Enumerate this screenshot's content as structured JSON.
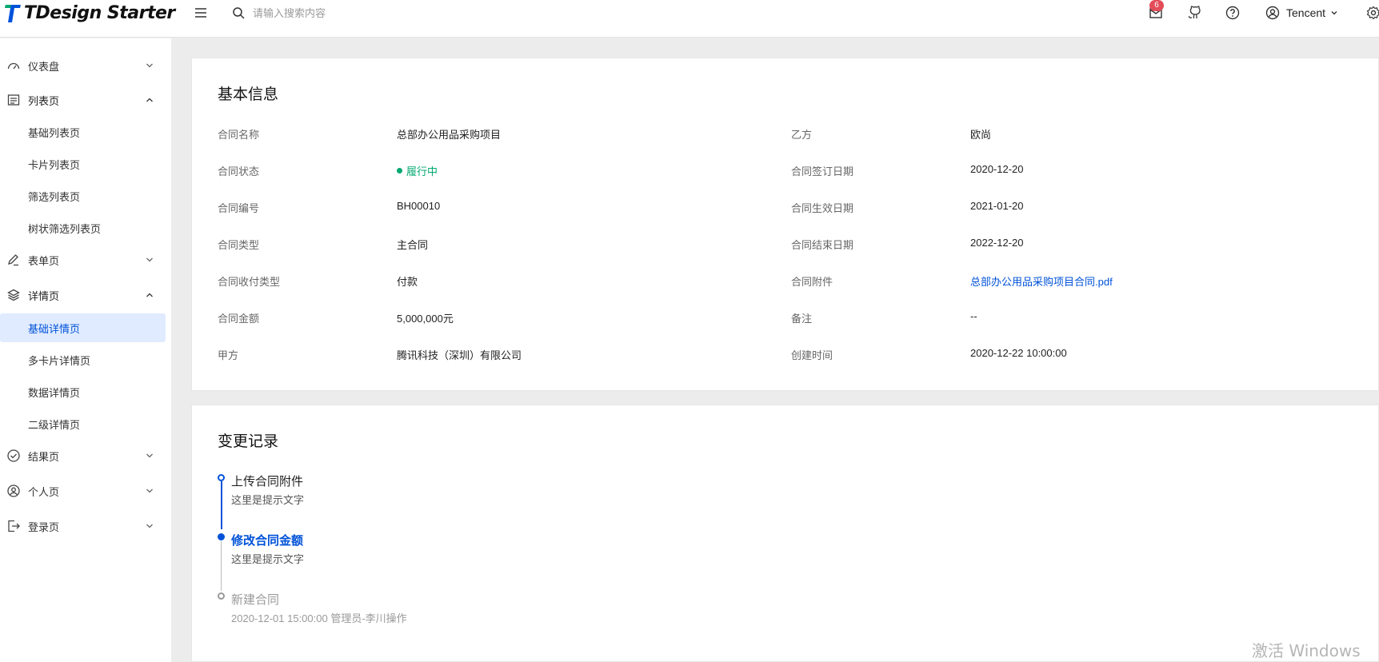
{
  "header": {
    "logo_text": "TDesign Starter",
    "search_placeholder": "请输入搜索内容",
    "notification_count": "6",
    "user_name": "Tencent"
  },
  "sidebar": {
    "items": [
      {
        "label": "仪表盘"
      },
      {
        "label": "列表页",
        "children": [
          "基础列表页",
          "卡片列表页",
          "筛选列表页",
          "树状筛选列表页"
        ]
      },
      {
        "label": "表单页"
      },
      {
        "label": "详情页",
        "children": [
          "基础详情页",
          "多卡片详情页",
          "数据详情页",
          "二级详情页"
        ]
      },
      {
        "label": "结果页"
      },
      {
        "label": "个人页"
      },
      {
        "label": "登录页"
      }
    ]
  },
  "basic_info": {
    "title": "基本信息",
    "left": [
      {
        "label": "合同名称",
        "value": "总部办公用品采购项目"
      },
      {
        "label": "合同状态",
        "value": "履行中"
      },
      {
        "label": "合同编号",
        "value": "BH00010"
      },
      {
        "label": "合同类型",
        "value": "主合同"
      },
      {
        "label": "合同收付类型",
        "value": "付款"
      },
      {
        "label": "合同金额",
        "value": "5,000,000元"
      },
      {
        "label": "甲方",
        "value": "腾讯科技（深圳）有限公司"
      }
    ],
    "right": [
      {
        "label": "乙方",
        "value": "欧尚"
      },
      {
        "label": "合同签订日期",
        "value": "2020-12-20"
      },
      {
        "label": "合同生效日期",
        "value": "2021-01-20"
      },
      {
        "label": "合同结束日期",
        "value": "2022-12-20"
      },
      {
        "label": "合同附件",
        "value": "总部办公用品采购项目合同.pdf"
      },
      {
        "label": "备注",
        "value": "--"
      },
      {
        "label": "创建时间",
        "value": "2020-12-22 10:00:00"
      }
    ]
  },
  "change_log": {
    "title": "变更记录",
    "events": [
      {
        "title": "上传合同附件",
        "desc": "这里是提示文字"
      },
      {
        "title": "修改合同金额",
        "desc": "这里是提示文字"
      },
      {
        "title": "新建合同",
        "desc": "2020-12-01 15:00:00 管理员-李川操作"
      }
    ]
  },
  "colors": {
    "primary": "#0052d9",
    "success": "#00a870",
    "badge": "#e34d59",
    "active_bg": "#e0ebff"
  },
  "watermark": "激活 Windows"
}
